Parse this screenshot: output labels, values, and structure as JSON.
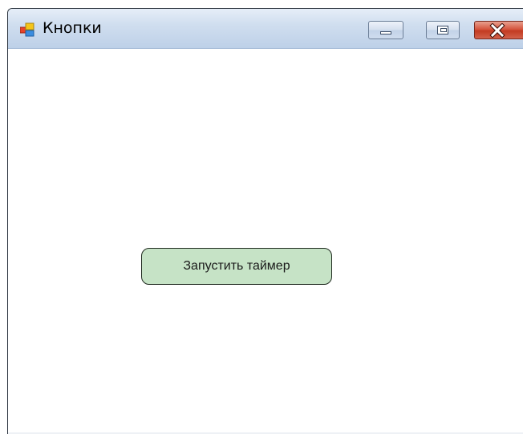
{
  "window": {
    "title": "Кнопки",
    "icon": "app-form-icon",
    "controls": {
      "minimize": "minimize-icon",
      "maximize": "maximize-icon",
      "close": "close-icon"
    }
  },
  "content": {
    "start_timer_button_label": "Запустить таймер"
  },
  "colors": {
    "button_background": "#c6e3c6",
    "titlebar": "#c8d8ec",
    "close_button": "#c84a33"
  }
}
